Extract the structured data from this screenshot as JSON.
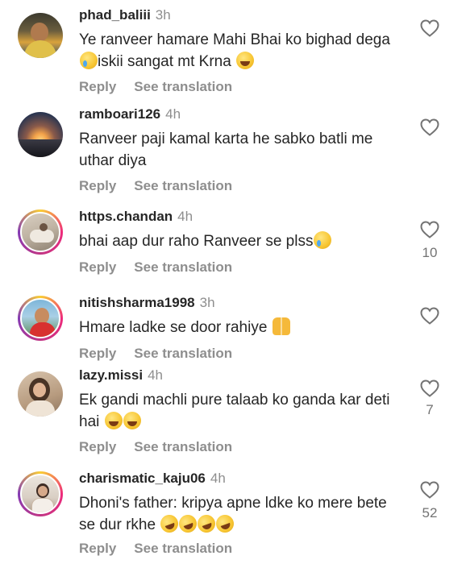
{
  "actions": {
    "reply": "Reply",
    "translate": "See translation"
  },
  "comments": [
    {
      "username": "phad_baliii",
      "time": "3h",
      "text_parts": [
        "Ye ranveer hamare Mahi Bhai ko bighad dega ",
        "iskii sangat mt Krna "
      ],
      "emojis": [
        "crying-face",
        "laughing-face"
      ],
      "likes": ""
    },
    {
      "username": "ramboari126",
      "time": "4h",
      "text_parts": [
        "Ranveer paji kamal karta he sabko batli me uthar diya"
      ],
      "emojis": [],
      "likes": ""
    },
    {
      "username": "https.chandan",
      "time": "4h",
      "text_parts": [
        "bhai aap dur raho Ranveer se plss"
      ],
      "emojis": [
        "crying-face"
      ],
      "likes": "10"
    },
    {
      "username": "nitishsharma1998",
      "time": "3h",
      "text_parts": [
        "Hmare ladke se door rahiye "
      ],
      "emojis": [
        "folded-hands"
      ],
      "likes": ""
    },
    {
      "username": "lazy.missi",
      "time": "4h",
      "text_parts": [
        "Ek gandi machli pure talaab ko ganda kar deti hai "
      ],
      "emojis": [
        "laughing-face",
        "laughing-face"
      ],
      "likes": "7"
    },
    {
      "username": "charismatic_kaju06",
      "time": "4h",
      "text_parts": [
        "Dhoni's father: kripya apne ldke ko mere bete se dur rkhe "
      ],
      "emojis": [
        "rolling-laughing-face",
        "rolling-laughing-face",
        "rolling-laughing-face",
        "rolling-laughing-face"
      ],
      "likes": "52"
    }
  ]
}
